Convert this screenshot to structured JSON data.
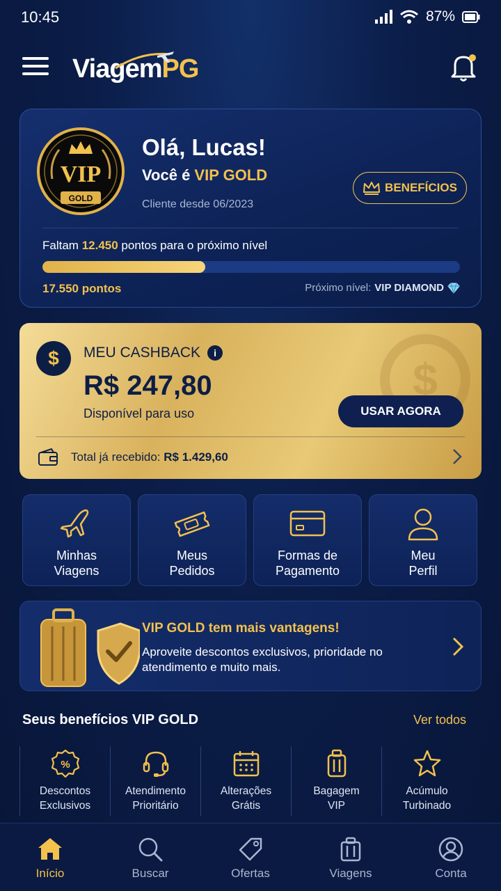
{
  "status_bar": {
    "time": "10:45",
    "battery": "87%"
  },
  "header": {
    "logo_main": "Viagem",
    "logo_accent": "PG"
  },
  "vip_card": {
    "badge_text": "VIP",
    "badge_ribbon": "GOLD",
    "greeting": "Olá, Lucas!",
    "level_prefix": "Você é ",
    "level_name": "VIP GOLD",
    "client_since": "Cliente desde 06/2023",
    "benefits_button": "BENEFÍCIOS",
    "remaining_prefix": "Faltam ",
    "remaining_points": "12.450",
    "remaining_suffix": " pontos para o próximo nível",
    "progress_fraction": 0.39,
    "points_label": "17.550 pontos",
    "next_level_prefix": "Próximo nível: ",
    "next_level_name": "VIP DIAMOND"
  },
  "cashback": {
    "title": "MEU CASHBACK",
    "amount": "R$ 247,80",
    "subtitle": "Disponível para uso",
    "use_button": "USAR AGORA",
    "total_prefix": "Total já recebido: ",
    "total_value": "R$ 1.429,60"
  },
  "quick_actions": [
    {
      "label": "Minhas\nViagens",
      "icon": "plane-icon"
    },
    {
      "label": "Meus\nPedidos",
      "icon": "ticket-icon"
    },
    {
      "label": "Formas de\nPagamento",
      "icon": "card-icon"
    },
    {
      "label": "Meu\nPerfil",
      "icon": "user-icon"
    }
  ],
  "promo": {
    "title": "VIP GOLD tem mais vantagens!",
    "description": "Aproveite descontos exclusivos, prioridade no atendimento e muito mais."
  },
  "benefits_section": {
    "title": "Seus benefícios VIP GOLD",
    "see_all": "Ver todos",
    "items": [
      {
        "label": "Descontos\nExclusivos",
        "icon": "percent-badge-icon"
      },
      {
        "label": "Atendimento\nPrioritário",
        "icon": "headset-icon"
      },
      {
        "label": "Alterações\nGrátis",
        "icon": "calendar-icon"
      },
      {
        "label": "Bagagem\nVIP",
        "icon": "luggage-icon"
      },
      {
        "label": "Acúmulo\nTurbinado",
        "icon": "star-icon"
      }
    ]
  },
  "bottom_nav": [
    {
      "label": "Início",
      "icon": "home-icon",
      "active": true
    },
    {
      "label": "Buscar",
      "icon": "search-icon",
      "active": false
    },
    {
      "label": "Ofertas",
      "icon": "tag-icon",
      "active": false
    },
    {
      "label": "Viagens",
      "icon": "suitcase-icon",
      "active": false
    },
    {
      "label": "Conta",
      "icon": "account-icon",
      "active": false
    }
  ],
  "colors": {
    "accent_gold": "#f2c14e",
    "background_navy": "#0b1d48",
    "text_dark": "#0d1e45"
  }
}
